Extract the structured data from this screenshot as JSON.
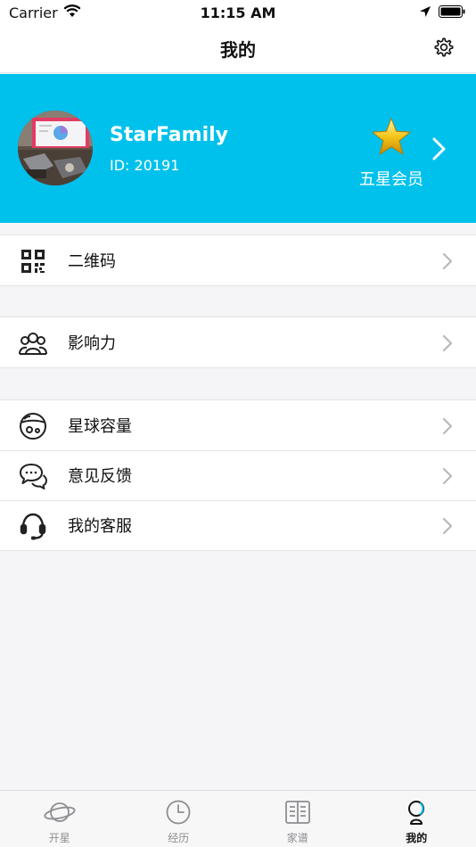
{
  "status_bar": {
    "carrier": "Carrier",
    "time": "11:15 AM"
  },
  "nav": {
    "title": "我的"
  },
  "profile": {
    "name": "StarFamily",
    "id_label": "ID: 20191",
    "membership": "五星会员",
    "accent_color": "#00c1ec"
  },
  "menu_groups": [
    {
      "items": [
        {
          "label": "二维码",
          "icon": "qr-code-icon"
        }
      ]
    },
    {
      "items": [
        {
          "label": "影响力",
          "icon": "group-people-icon"
        }
      ]
    },
    {
      "items": [
        {
          "label": "星球容量",
          "icon": "planet-capacity-icon"
        },
        {
          "label": "意见反馈",
          "icon": "chat-bubbles-icon"
        },
        {
          "label": "我的客服",
          "icon": "headset-icon"
        }
      ]
    }
  ],
  "tabs": [
    {
      "label": "开星",
      "icon": "planet-icon"
    },
    {
      "label": "经历",
      "icon": "clock-icon"
    },
    {
      "label": "家谱",
      "icon": "book-icon"
    },
    {
      "label": "我的",
      "icon": "profile-icon",
      "active": true
    }
  ]
}
